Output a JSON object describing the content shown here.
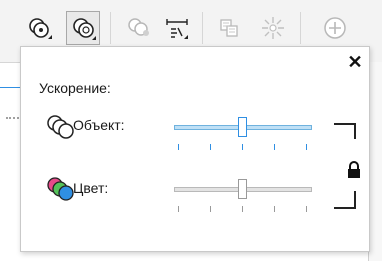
{
  "toolbar": {
    "buttons": [
      {
        "icon": "transparency-icon"
      },
      {
        "icon": "color-transparency-icon"
      },
      {
        "icon": "fill-icon"
      },
      {
        "icon": "blend-steps-icon"
      },
      {
        "icon": "copy-properties-icon"
      },
      {
        "icon": "radial-icon"
      },
      {
        "icon": "add-icon"
      }
    ]
  },
  "popup": {
    "title": "Ускорение:",
    "close_label": "✕",
    "object": {
      "label": "Объект:",
      "value": 0.5
    },
    "color": {
      "label": "Цвет:",
      "value": 0.5
    },
    "lock_icon": "lock-icon"
  },
  "colors": {
    "accent": "#2f8fe3",
    "active_track": "#bfe0f6",
    "disabled_track": "#e3e3e3"
  }
}
